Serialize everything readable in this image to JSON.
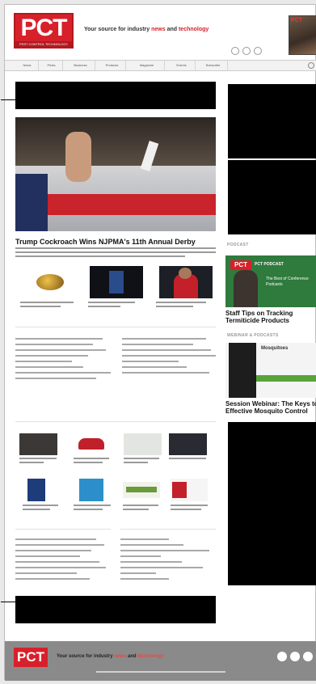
{
  "brand": {
    "logo_text": "PCT",
    "logo_sub": "PEST CONTROL TECHNOLOGY"
  },
  "header": {
    "tagline_prefix": "Your source for industry ",
    "tagline_news": "news",
    "tagline_and": " and ",
    "tagline_tech": "technology"
  },
  "magazine": {
    "title": "PCT"
  },
  "nav": {
    "items": [
      "News",
      "Pests",
      "Business",
      "Products",
      "Magazine",
      "Events",
      "Subscribe"
    ]
  },
  "hero": {
    "headline": "Trump Cockroach Wins NJPMA's 11th Annual Derby"
  },
  "podcast": {
    "label": "PCT PODCAST",
    "tile_text": "The Best of Conference Podcasts",
    "headline": "Staff Tips on Tracking Termiticide Products"
  },
  "webinar": {
    "headline": "Session Webinar: The Keys to Effective Mosquito Control",
    "logo": "Mosquitoes"
  },
  "sections": {
    "podcast_label": "PODCAST",
    "webinar_label": "WEBINAR & PODCASTS"
  },
  "footer": {
    "logo_text": "PCT",
    "tagline_prefix": "Your source for industry ",
    "tagline_news": "news",
    "tagline_and": " and ",
    "tagline_tech": "technology"
  },
  "colors": {
    "brand_red": "#d8202a",
    "podcast_green": "#2f7a3d",
    "footer_gray": "#8a8a8a"
  }
}
